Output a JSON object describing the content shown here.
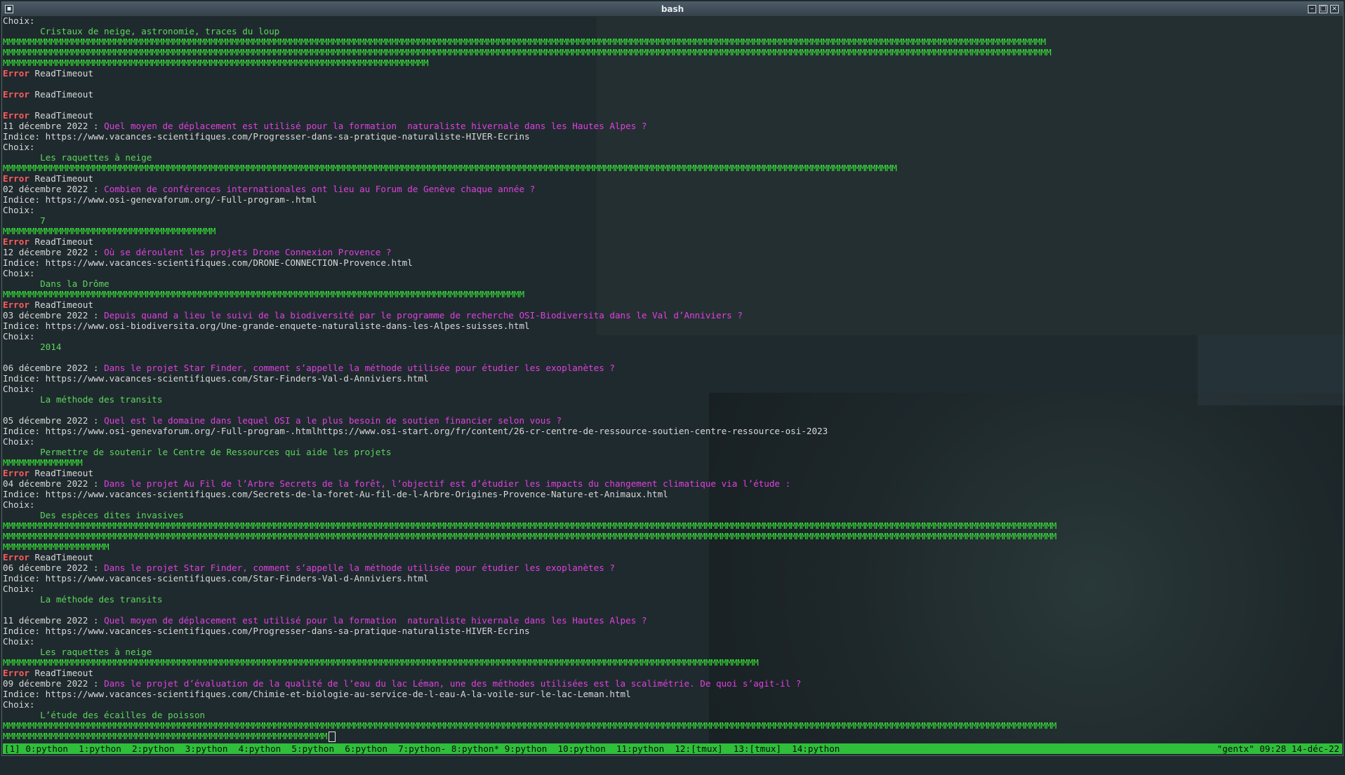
{
  "window": {
    "title": "bash"
  },
  "terminal_lines": [
    {
      "segments": [
        {
          "t": "Choix:",
          "c": "plain"
        }
      ]
    },
    {
      "segments": [
        {
          "t": "       Cristaux de neige, astronomie, traces du loup",
          "c": "ans"
        }
      ]
    },
    {
      "segments": [
        {
          "t": "MMMMMMMMMMMMMMMMMMMMMMMMMMMMMMMMMMMMMMMMMMMMMMMMMMMMMMMMMMMMMMMMMMMMMMMMMMMMMMMMMMMMMMMMMMMMMMMMMMMMMMMMMMMMMMMMMMMMMMMMMMMMMMMMMMMMMMMMMMMMMMMMMMMMMMMMMMMMMMMMMMMMMMMMMMMMMMMMMMMMMMMMMMMMMMMMMMMM",
          "c": "mm"
        }
      ]
    },
    {
      "segments": [
        {
          "t": "MMMMMMMMMMMMMMMMMMMMMMMMMMMMMMMMMMMMMMMMMMMMMMMMMMMMMMMMMMMMMMMMMMMMMMMMMMMMMMMMMMMMMMMMMMMMMMMMMMMMMMMMMMMMMMMMMMMMMMMMMMMMMMMMMMMMMMMMMMMMMMMMMMMMMMMMMMMMMMMMMMMMMMMMMMMMMMMMMMMMMMMMMMMMMMMMMMMMM",
          "c": "mm"
        }
      ]
    },
    {
      "segments": [
        {
          "t": "MMMMMMMMMMMMMMMMMMMMMMMMMMMMMMMMMMMMMMMMMMMMMMMMMMMMMMMMMMMMMMMMMMMMMMMMMMMMMMMM",
          "c": "mm"
        }
      ]
    },
    {
      "segments": [
        {
          "t": "Error",
          "c": "err"
        },
        {
          "t": " ReadTimeout",
          "c": "plain"
        }
      ]
    },
    {
      "segments": [
        {
          "t": "",
          "c": "plain"
        }
      ]
    },
    {
      "segments": [
        {
          "t": "Error",
          "c": "err"
        },
        {
          "t": " ReadTimeout",
          "c": "plain"
        }
      ]
    },
    {
      "segments": [
        {
          "t": "",
          "c": "plain"
        }
      ]
    },
    {
      "segments": [
        {
          "t": "Error",
          "c": "err"
        },
        {
          "t": " ReadTimeout",
          "c": "plain"
        }
      ]
    },
    {
      "segments": [
        {
          "t": "11 décembre 2022 : ",
          "c": "plain"
        },
        {
          "t": "Quel moyen de déplacement est utilisé pour la formation  naturaliste hivernale dans les Hautes Alpes ?",
          "c": "q"
        }
      ]
    },
    {
      "segments": [
        {
          "t": "Indice: https://www.vacances-scientifiques.com/Progresser-dans-sa-pratique-naturaliste-HIVER-Ecrins",
          "c": "plain"
        }
      ]
    },
    {
      "segments": [
        {
          "t": "Choix:",
          "c": "plain"
        }
      ]
    },
    {
      "segments": [
        {
          "t": "       Les raquettes à neige",
          "c": "ans"
        }
      ]
    },
    {
      "segments": [
        {
          "t": "MMMMMMMMMMMMMMMMMMMMMMMMMMMMMMMMMMMMMMMMMMMMMMMMMMMMMMMMMMMMMMMMMMMMMMMMMMMMMMMMMMMMMMMMMMMMMMMMMMMMMMMMMMMMMMMMMMMMMMMMMMMMMMMMMMMMMMMMMMMMMMMMMMMMMMMMMMMMMMMMMMMMMMMM",
          "c": "mm"
        }
      ]
    },
    {
      "segments": [
        {
          "t": "Error",
          "c": "err"
        },
        {
          "t": " ReadTimeout",
          "c": "plain"
        }
      ]
    },
    {
      "segments": [
        {
          "t": "02 décembre 2022 : ",
          "c": "plain"
        },
        {
          "t": "Combien de conférences internationales ont lieu au Forum de Genève chaque année ?",
          "c": "q"
        }
      ]
    },
    {
      "segments": [
        {
          "t": "Indice: https://www.osi-genevaforum.org/-Full-program-.html",
          "c": "plain"
        }
      ]
    },
    {
      "segments": [
        {
          "t": "Choix:",
          "c": "plain"
        }
      ]
    },
    {
      "segments": [
        {
          "t": "       7",
          "c": "ans"
        }
      ]
    },
    {
      "segments": [
        {
          "t": "MMMMMMMMMMMMMMMMMMMMMMMMMMMMMMMMMMMMMMMM",
          "c": "mm"
        }
      ]
    },
    {
      "segments": [
        {
          "t": "Error",
          "c": "err"
        },
        {
          "t": " ReadTimeout",
          "c": "plain"
        }
      ]
    },
    {
      "segments": [
        {
          "t": "12 décembre 2022 : ",
          "c": "plain"
        },
        {
          "t": "Où se déroulent les projets Drone Connexion Provence ?",
          "c": "q"
        }
      ]
    },
    {
      "segments": [
        {
          "t": "Indice: https://www.vacances-scientifiques.com/DRONE-CONNECTION-Provence.html",
          "c": "plain"
        }
      ]
    },
    {
      "segments": [
        {
          "t": "Choix:",
          "c": "plain"
        }
      ]
    },
    {
      "segments": [
        {
          "t": "       Dans la Drôme",
          "c": "ans"
        }
      ]
    },
    {
      "segments": [
        {
          "t": "MMMMMMMMMMMMMMMMMMMMMMMMMMMMMMMMMMMMMMMMMMMMMMMMMMMMMMMMMMMMMMMMMMMMMMMMMMMMMMMMMMMMMMMMMMMMMMMMMM",
          "c": "mm"
        }
      ]
    },
    {
      "segments": [
        {
          "t": "Error",
          "c": "err"
        },
        {
          "t": " ReadTimeout",
          "c": "plain"
        }
      ]
    },
    {
      "segments": [
        {
          "t": "03 décembre 2022 : ",
          "c": "plain"
        },
        {
          "t": "Depuis quand a lieu le suivi de la biodiversité par le programme de recherche OSI-Biodiversita dans le Val d’Anniviers ?",
          "c": "q"
        }
      ]
    },
    {
      "segments": [
        {
          "t": "Indice: https://www.osi-biodiversita.org/Une-grande-enquete-naturaliste-dans-les-Alpes-suisses.html",
          "c": "plain"
        }
      ]
    },
    {
      "segments": [
        {
          "t": "Choix:",
          "c": "plain"
        }
      ]
    },
    {
      "segments": [
        {
          "t": "       2014",
          "c": "ans"
        }
      ]
    },
    {
      "segments": [
        {
          "t": "",
          "c": "plain"
        }
      ]
    },
    {
      "segments": [
        {
          "t": "06 décembre 2022 : ",
          "c": "plain"
        },
        {
          "t": "Dans le projet Star Finder, comment s’appelle la méthode utilisée pour étudier les exoplanètes ?",
          "c": "q"
        }
      ]
    },
    {
      "segments": [
        {
          "t": "Indice: https://www.vacances-scientifiques.com/Star-Finders-Val-d-Anniviers.html",
          "c": "plain"
        }
      ]
    },
    {
      "segments": [
        {
          "t": "Choix:",
          "c": "plain"
        }
      ]
    },
    {
      "segments": [
        {
          "t": "       La méthode des transits",
          "c": "ans"
        }
      ]
    },
    {
      "segments": [
        {
          "t": "",
          "c": "plain"
        }
      ]
    },
    {
      "segments": [
        {
          "t": "05 décembre 2022 : ",
          "c": "plain"
        },
        {
          "t": "Quel est le domaine dans lequel OSI a le plus besoin de soutien financier selon vous ?",
          "c": "q"
        }
      ]
    },
    {
      "segments": [
        {
          "t": "Indice: https://www.osi-genevaforum.org/-Full-program-.htmlhttps://www.osi-start.org/fr/content/26-cr-centre-de-ressource-soutien-centre-ressource-osi-2023",
          "c": "plain"
        }
      ]
    },
    {
      "segments": [
        {
          "t": "Choix:",
          "c": "plain"
        }
      ]
    },
    {
      "segments": [
        {
          "t": "       Permettre de soutenir le Centre de Ressources qui aide les projets",
          "c": "ans"
        }
      ]
    },
    {
      "segments": [
        {
          "t": "MMMMMMMMMMMMMMM",
          "c": "mm"
        }
      ]
    },
    {
      "segments": [
        {
          "t": "Error",
          "c": "err"
        },
        {
          "t": " ReadTimeout",
          "c": "plain"
        }
      ]
    },
    {
      "segments": [
        {
          "t": "04 décembre 2022 : ",
          "c": "plain"
        },
        {
          "t": "Dans le projet Au Fil de l’Arbre Secrets de la forêt, l’objectif est d’étudier les impacts du changement climatique via l’étude :",
          "c": "q"
        }
      ]
    },
    {
      "segments": [
        {
          "t": "Indice: https://www.vacances-scientifiques.com/Secrets-de-la-foret-Au-fil-de-l-Arbre-Origines-Provence-Nature-et-Animaux.html",
          "c": "plain"
        }
      ]
    },
    {
      "segments": [
        {
          "t": "Choix:",
          "c": "plain"
        }
      ]
    },
    {
      "segments": [
        {
          "t": "       Des espèces dites invasives",
          "c": "ans"
        }
      ]
    },
    {
      "segments": [
        {
          "t": "MMMMMMMMMMMMMMMMMMMMMMMMMMMMMMMMMMMMMMMMMMMMMMMMMMMMMMMMMMMMMMMMMMMMMMMMMMMMMMMMMMMMMMMMMMMMMMMMMMMMMMMMMMMMMMMMMMMMMMMMMMMMMMMMMMMMMMMMMMMMMMMMMMMMMMMMMMMMMMMMMMMMMMMMMMMMMMMMMMMMMMMMMMMMMMMMMMMMMM",
          "c": "mm"
        }
      ]
    },
    {
      "segments": [
        {
          "t": "MMMMMMMMMMMMMMMMMMMMMMMMMMMMMMMMMMMMMMMMMMMMMMMMMMMMMMMMMMMMMMMMMMMMMMMMMMMMMMMMMMMMMMMMMMMMMMMMMMMMMMMMMMMMMMMMMMMMMMMMMMMMMMMMMMMMMMMMMMMMMMMMMMMMMMMMMMMMMMMMMMMMMMMMMMMMMMMMMMMMMMMMMMMMMMMMMMMMMM",
          "c": "mm"
        }
      ]
    },
    {
      "segments": [
        {
          "t": "MMMMMMMMMMMMMMMMMMMM",
          "c": "mm"
        }
      ]
    },
    {
      "segments": [
        {
          "t": "Error",
          "c": "err"
        },
        {
          "t": " ReadTimeout",
          "c": "plain"
        }
      ]
    },
    {
      "segments": [
        {
          "t": "06 décembre 2022 : ",
          "c": "plain"
        },
        {
          "t": "Dans le projet Star Finder, comment s’appelle la méthode utilisée pour étudier les exoplanètes ?",
          "c": "q"
        }
      ]
    },
    {
      "segments": [
        {
          "t": "Indice: https://www.vacances-scientifiques.com/Star-Finders-Val-d-Anniviers.html",
          "c": "plain"
        }
      ]
    },
    {
      "segments": [
        {
          "t": "Choix:",
          "c": "plain"
        }
      ]
    },
    {
      "segments": [
        {
          "t": "       La méthode des transits",
          "c": "ans"
        }
      ]
    },
    {
      "segments": [
        {
          "t": "",
          "c": "plain"
        }
      ]
    },
    {
      "segments": [
        {
          "t": "11 décembre 2022 : ",
          "c": "plain"
        },
        {
          "t": "Quel moyen de déplacement est utilisé pour la formation  naturaliste hivernale dans les Hautes Alpes ?",
          "c": "q"
        }
      ]
    },
    {
      "segments": [
        {
          "t": "Indice: https://www.vacances-scientifiques.com/Progresser-dans-sa-pratique-naturaliste-HIVER-Ecrins",
          "c": "plain"
        }
      ]
    },
    {
      "segments": [
        {
          "t": "Choix:",
          "c": "plain"
        }
      ]
    },
    {
      "segments": [
        {
          "t": "       Les raquettes à neige",
          "c": "ans"
        }
      ]
    },
    {
      "segments": [
        {
          "t": "MMMMMMMMMMMMMMMMMMMMMMMMMMMMMMMMMMMMMMMMMMMMMMMMMMMMMMMMMMMMMMMMMMMMMMMMMMMMMMMMMMMMMMMMMMMMMMMMMMMMMMMMMMMMMMMMMMMMMMMMMMMMMMMMMMMMMMMMMMMMMM",
          "c": "mm"
        }
      ]
    },
    {
      "segments": [
        {
          "t": "Error",
          "c": "err"
        },
        {
          "t": " ReadTimeout",
          "c": "plain"
        }
      ]
    },
    {
      "segments": [
        {
          "t": "09 décembre 2022 : ",
          "c": "plain"
        },
        {
          "t": "Dans le projet d’évaluation de la qualité de l’eau du lac Léman, une des méthodes utilisées est la scalimétrie. De quoi s’agit-il ?",
          "c": "q"
        }
      ]
    },
    {
      "segments": [
        {
          "t": "Indice: https://www.vacances-scientifiques.com/Chimie-et-biologie-au-service-de-l-eau-A-la-voile-sur-le-lac-Leman.html",
          "c": "plain"
        }
      ]
    },
    {
      "segments": [
        {
          "t": "Choix:",
          "c": "plain"
        }
      ]
    },
    {
      "segments": [
        {
          "t": "       L’étude des écailles de poisson",
          "c": "ans"
        }
      ]
    },
    {
      "segments": [
        {
          "t": "MMMMMMMMMMMMMMMMMMMMMMMMMMMMMMMMMMMMMMMMMMMMMMMMMMMMMMMMMMMMMMMMMMMMMMMMMMMMMMMMMMMMMMMMMMMMMMMMMMMMMMMMMMMMMMMMMMMMMMMMMMMMMMMMMMMMMMMMMMMMMMMMMMMMMMMMMMMMMMMMMMMMMMMMMMMMMMMMMMMMMMMMMMMMMMMMMMMMMM",
          "c": "mm"
        }
      ]
    },
    {
      "segments": [
        {
          "t": "MMMMMMMMMMMMMMMMMMMMMMMMMMMMMMMMMMMMMMMMMMMMMMMMMMMMMMMMMMMMM",
          "c": "mm"
        }
      ],
      "cursor": true
    }
  ],
  "statusbar": {
    "left": "[1] 0:python  1:python  2:python  3:python  4:python  5:python  6:python  7:python- 8:python* 9:python  10:python  11:python  12:[tmux]  13:[tmux]  14:python",
    "right": "\"gentx\" 09:28 14-déc-22"
  },
  "colors": {
    "background": "#1f2a2e",
    "error": "#ff5b5b",
    "question": "#e040e0",
    "answer": "#5cd65c",
    "separator": "#38e838",
    "statusbar": "#2fbf3a"
  }
}
